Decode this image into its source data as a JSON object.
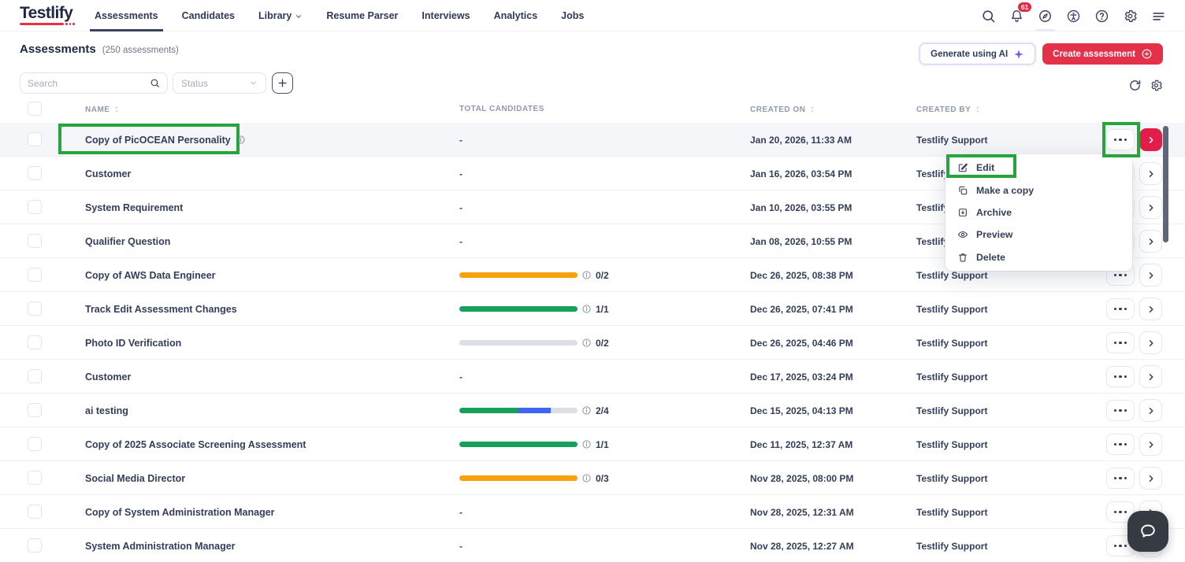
{
  "brand": {
    "logo": "Testlify"
  },
  "nav": {
    "items": [
      {
        "label": "Assessments",
        "active": true,
        "dropdown": false
      },
      {
        "label": "Candidates",
        "active": false,
        "dropdown": false
      },
      {
        "label": "Library",
        "active": false,
        "dropdown": true
      },
      {
        "label": "Resume Parser",
        "active": false,
        "dropdown": false
      },
      {
        "label": "Interviews",
        "active": false,
        "dropdown": false
      },
      {
        "label": "Analytics",
        "active": false,
        "dropdown": false
      },
      {
        "label": "Jobs",
        "active": false,
        "dropdown": false
      }
    ]
  },
  "topbar_icons": [
    {
      "key": "search",
      "name": "search-icon"
    },
    {
      "key": "bell",
      "name": "notifications-icon",
      "badge": "61"
    },
    {
      "key": "compass",
      "name": "explore-icon",
      "underlined": true
    },
    {
      "key": "accessibility",
      "name": "accessibility-icon"
    },
    {
      "key": "help",
      "name": "help-icon"
    },
    {
      "key": "gear",
      "name": "settings-icon"
    },
    {
      "key": "menu",
      "name": "menu-icon"
    }
  ],
  "page": {
    "title": "Assessments",
    "subtitle": "(250 assessments)",
    "generate_ai_label": "Generate using AI",
    "create_label": "Create assessment"
  },
  "filters": {
    "search_placeholder": "Search",
    "status_label": "Status"
  },
  "table": {
    "columns": [
      {
        "label": "NAME",
        "sortable": true
      },
      {
        "label": "TOTAL CANDIDATES",
        "sortable": false
      },
      {
        "label": "CREATED ON",
        "sortable": true
      },
      {
        "label": "CREATED BY",
        "sortable": true
      }
    ],
    "rows": [
      {
        "name": "Copy of PicOCEAN Personality",
        "info": true,
        "progress": null,
        "created_on": "Jan 20, 2026, 11:33 AM",
        "created_by": "Testlify Support",
        "highlighted": true
      },
      {
        "name": "Customer",
        "info": false,
        "progress": null,
        "created_on": "Jan 16, 2026, 03:54 PM",
        "created_by": "Testlify Support",
        "highlighted": false
      },
      {
        "name": "System Requirement",
        "info": false,
        "progress": null,
        "created_on": "Jan 10, 2026, 03:55 PM",
        "created_by": "Testlify Support",
        "highlighted": false
      },
      {
        "name": "Qualifier Question",
        "info": false,
        "progress": null,
        "created_on": "Jan 08, 2026, 10:55 PM",
        "created_by": "Testlify Support",
        "highlighted": false
      },
      {
        "name": "Copy of AWS Data Engineer",
        "info": false,
        "progress": {
          "segments": [
            {
              "color": "orange",
              "pct": 100
            }
          ],
          "label": "0/2"
        },
        "created_on": "Dec 26, 2025, 08:38 PM",
        "created_by": "Testlify Support",
        "highlighted": false
      },
      {
        "name": "Track Edit Assessment Changes",
        "info": false,
        "progress": {
          "segments": [
            {
              "color": "green",
              "pct": 100
            }
          ],
          "label": "1/1"
        },
        "created_on": "Dec 26, 2025, 07:41 PM",
        "created_by": "Testlify Support",
        "highlighted": false
      },
      {
        "name": "Photo ID Verification",
        "info": false,
        "progress": {
          "segments": [
            {
              "color": "gray",
              "pct": 100
            }
          ],
          "label": "0/2"
        },
        "created_on": "Dec 26, 2025, 04:46 PM",
        "created_by": "Testlify Support",
        "highlighted": false
      },
      {
        "name": "Customer",
        "info": false,
        "progress": null,
        "created_on": "Dec 17, 2025, 03:24 PM",
        "created_by": "Testlify Support",
        "highlighted": false
      },
      {
        "name": "ai testing",
        "info": false,
        "progress": {
          "segments": [
            {
              "color": "green",
              "pct": 50
            },
            {
              "color": "blue",
              "pct": 27
            },
            {
              "color": "gray",
              "pct": 23
            }
          ],
          "label": "2/4"
        },
        "created_on": "Dec 15, 2025, 04:13 PM",
        "created_by": "Testlify Support",
        "highlighted": false
      },
      {
        "name": "Copy of 2025 Associate Screening Assessment",
        "info": false,
        "progress": {
          "segments": [
            {
              "color": "green",
              "pct": 100
            }
          ],
          "label": "1/1"
        },
        "created_on": "Dec 11, 2025, 12:37 AM",
        "created_by": "Testlify Support",
        "highlighted": false
      },
      {
        "name": "Social Media Director",
        "info": false,
        "progress": {
          "segments": [
            {
              "color": "orange",
              "pct": 100
            }
          ],
          "label": "0/3"
        },
        "created_on": "Nov 28, 2025, 08:00 PM",
        "created_by": "Testlify Support",
        "highlighted": false
      },
      {
        "name": "Copy of System Administration Manager",
        "info": false,
        "progress": null,
        "created_on": "Nov 28, 2025, 12:31 AM",
        "created_by": "Testlify Support",
        "highlighted": false
      },
      {
        "name": "System Administration Manager",
        "info": false,
        "progress": null,
        "created_on": "Nov 28, 2025, 12:27 AM",
        "created_by": "Testlify Support",
        "highlighted": false
      }
    ],
    "empty_value": "-"
  },
  "context_menu": {
    "items": [
      {
        "label": "Edit",
        "icon": "edit"
      },
      {
        "label": "Make a copy",
        "icon": "copy"
      },
      {
        "label": "Archive",
        "icon": "archive"
      },
      {
        "label": "Preview",
        "icon": "eye"
      },
      {
        "label": "Delete",
        "icon": "trash"
      }
    ]
  },
  "colors": {
    "orange": "#f9a10b",
    "green": "#17a05b",
    "blue": "#3e66f3",
    "gray": "#dcdfe5",
    "brand_red": "#e5304a",
    "row_action_red": "#e11d48",
    "annotation_green": "#26a53c",
    "sparkle_purple": "#7d58e8"
  }
}
